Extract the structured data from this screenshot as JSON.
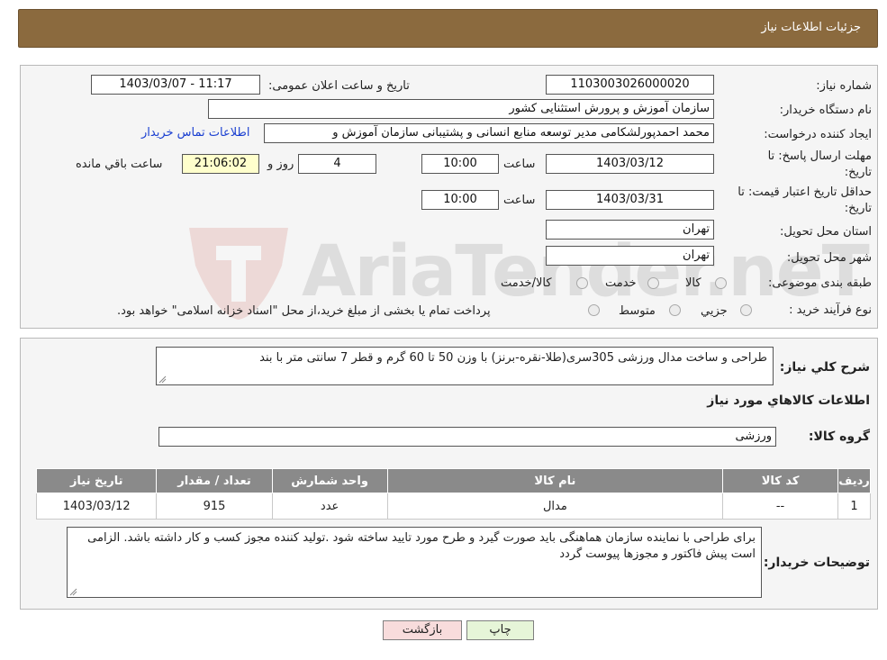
{
  "header": {
    "title": "جزئیات اطلاعات نیاز"
  },
  "need_info": {
    "need_number_label": "شماره نیاز:",
    "need_number": "1103003026000020",
    "announce_label": "تاریخ و ساعت اعلان عمومی:",
    "announce_value": "1403/03/07 - 11:17",
    "buyer_org_label": "نام دستگاه خریدار:",
    "buyer_org": "سازمان آموزش و پرورش استثنایی کشور",
    "requester_label": "ایجاد کننده درخواست:",
    "requester": "محمد احمدپورلشکامی مدیر توسعه منابع انسانی و پشتیبانی سازمان آموزش و",
    "contact_link": "اطلاعات تماس خریدار",
    "reply_deadline_label_1": "مهلت ارسال پاسخ: تا",
    "reply_deadline_label_2": "تاریخ:",
    "reply_date": "1403/03/12",
    "time_label": "ساعت",
    "reply_time": "10:00",
    "days": "4",
    "days_label": "روز و",
    "remaining_time": "21:06:02",
    "remaining_label": "ساعت باقي مانده",
    "validity_label_1": "حداقل تاریخ اعتبار قیمت: تا",
    "validity_label_2": "تاریخ:",
    "validity_date": "1403/03/31",
    "validity_time_label": "ساعت",
    "validity_time": "10:00",
    "province_label": "استان محل تحویل:",
    "province": "تهران",
    "city_label": "شهر محل تحویل:",
    "city": "تهران",
    "category_label": "طبقه بندی موضوعی:",
    "category_options": [
      "کالا",
      "خدمت",
      "کالا/خدمت"
    ],
    "process_label": "نوع فرآیند خرید :",
    "process_options": [
      "جزيي",
      "متوسط"
    ],
    "process_note": "پرداخت تمام یا بخشی از مبلغ خرید،از محل \"اسناد خزانه اسلامی\" خواهد بود."
  },
  "description": {
    "label": "شرح کلي نياز:",
    "value": "طراحی و ساخت مدال ورزشی 305سری(طلا-نقره-برنز) با وزن 50 تا 60 گرم و قطر 7 سانتی متر با بند"
  },
  "goods": {
    "section_title": "اطلاعات کالاهاي مورد نياز",
    "group_label": "گروه کالا:",
    "group_value": "ورزشی",
    "columns": [
      "رديف",
      "کد کالا",
      "نام کالا",
      "واحد شمارش",
      "تعداد / مقدار",
      "تاريخ نياز"
    ],
    "rows": [
      {
        "row": "1",
        "code": "--",
        "name": "مدال",
        "unit": "عدد",
        "qty": "915",
        "date": "1403/03/12"
      }
    ]
  },
  "buyer_notes": {
    "label": "توضیحات خریدار:",
    "value": "برای طراحی با نماینده سازمان هماهنگی باید صورت گیرد و طرح مورد تایید ساخته شود .تولید کننده مجوز کسب و کار داشته باشد. الزامی است پیش فاکتور و مجوزها پیوست گردد"
  },
  "buttons": {
    "print": "چاپ",
    "back": "بازگشت"
  },
  "colors": {
    "header_bg": "#8b6a3e",
    "table_header": "#8a8a8a",
    "back_button": "#f8dcdc",
    "print_button": "#e6f5d8"
  },
  "watermark": {
    "text": "AriaTender.neT"
  }
}
